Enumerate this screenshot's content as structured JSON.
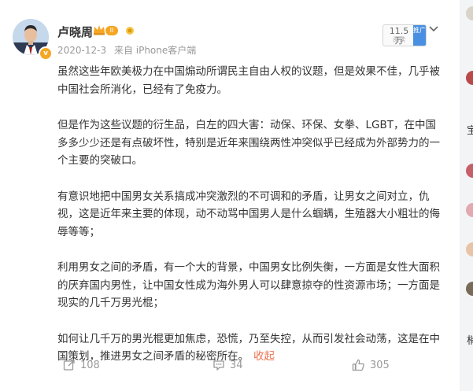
{
  "post": {
    "author": "卢晓周",
    "level_badge": "II",
    "verified_mark": "v",
    "date": "2020-12-3",
    "source": "来自 iPhone客户端",
    "read_count": "11.5万",
    "read_label": "阅读",
    "promote_label": "推广",
    "paragraphs": [
      "虽然这些年欧美极力在中国煽动所谓民主自由人权的议题，但是效果不佳，几乎被中国社会所消化，已经有了免疫力。",
      "但是作为这些议题的衍生品，白左的四大害：动保、环保、女拳、LGBT，在中国多多少少还是有点破坏性，特别是近年来围绕两性冲突似乎已经成为外部势力的一个主要的突破口。",
      "有意识地把中国男女关系搞成冲突激烈的不可调和的矛盾，让男女之间对立，仇视，这是近年来主要的体现，动不动骂中国男人是什么蝈螨，生殖器大小粗壮的侮辱等等；",
      "利用男女之间的矛盾，有一个大的背景，中国男女比例失衡，一方面是女性大面积的厌弃国内男性，让中国女性成为海外男人可以肆意掠夺的性资源市场；一方面是现实的几千万男光棍；",
      "如何让几千万的男光棍更加焦虑，恐慌，乃至失控，从而引发社会动荡，这是在中国策划，推进男女之间矛盾的秘密所在。"
    ],
    "collapse_label": "收起"
  },
  "actions": {
    "repost_count": "108",
    "comment_count": "34",
    "like_count": "305"
  },
  "sidebar": {
    "chars": [
      "宝",
      "梢"
    ]
  },
  "icons": {
    "repost": "share-icon",
    "comment": "comment-icon",
    "like": "like-icon",
    "chevron": "chevron-down-icon",
    "crown": "crown-icon"
  },
  "colors": {
    "accent_link": "#eb7350",
    "muted_text": "#999999",
    "badge_orange": "#f5a623",
    "promo_blue": "#4a90e2"
  }
}
